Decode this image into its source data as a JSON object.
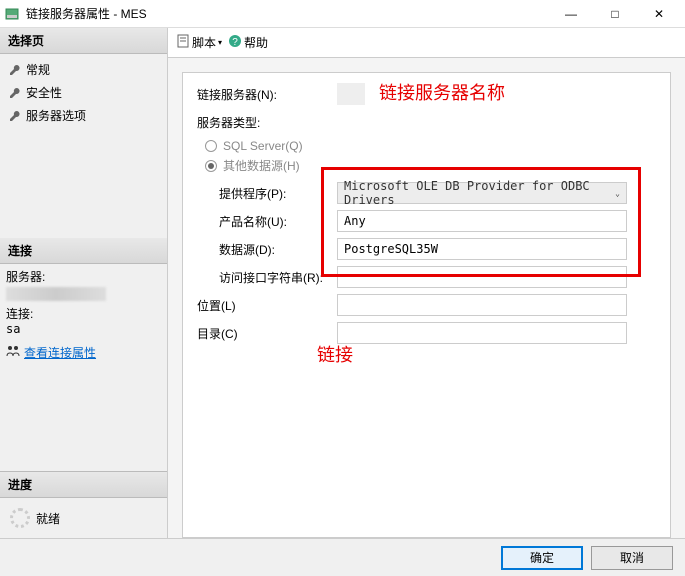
{
  "window": {
    "title": "链接服务器属性 - MES"
  },
  "winbtns": {
    "min": "—",
    "max": "□",
    "close": "✕"
  },
  "sidebar": {
    "select_page": "选择页",
    "nav": [
      {
        "label": "常规"
      },
      {
        "label": "安全性"
      },
      {
        "label": "服务器选项"
      }
    ],
    "connection_header": "连接",
    "server_label": "服务器:",
    "conn_label": "连接:",
    "conn_value": "sa",
    "view_conn_props": "查看连接属性",
    "progress_header": "进度",
    "ready": "就绪"
  },
  "toolbar": {
    "script": "脚本",
    "help": "帮助",
    "dropdown": "▾"
  },
  "form": {
    "linked_server_label": "链接服务器(N):",
    "server_type_label": "服务器类型:",
    "radio_sql": "SQL Server(Q)",
    "radio_other": "其他数据源(H)",
    "provider_label": "提供程序(P):",
    "provider_value": "Microsoft OLE DB Provider for ODBC Drivers",
    "product_label": "产品名称(U):",
    "product_value": "Any",
    "datasource_label": "数据源(D):",
    "datasource_value": "PostgreSQL35W",
    "provstring_label": "访问接口字符串(R):",
    "provstring_value": "",
    "location_label": "位置(L)",
    "location_value": "",
    "catalog_label": "目录(C)",
    "catalog_value": ""
  },
  "annotations": {
    "a1": "链接服务器名称",
    "a2": "链接"
  },
  "footer": {
    "ok": "确定",
    "cancel": "取消"
  }
}
